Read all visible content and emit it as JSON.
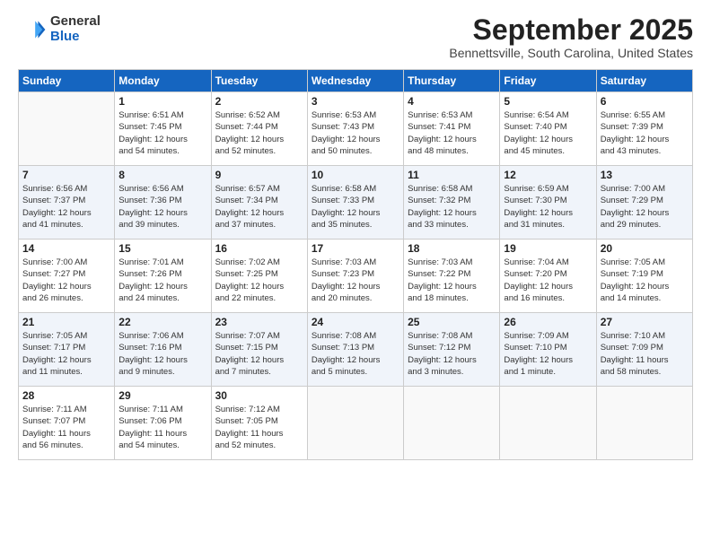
{
  "logo": {
    "general": "General",
    "blue": "Blue"
  },
  "title": {
    "month_year": "September 2025",
    "location": "Bennettsville, South Carolina, United States"
  },
  "days_of_week": [
    "Sunday",
    "Monday",
    "Tuesday",
    "Wednesday",
    "Thursday",
    "Friday",
    "Saturday"
  ],
  "weeks": [
    [
      {
        "day": "",
        "info": ""
      },
      {
        "day": "1",
        "info": "Sunrise: 6:51 AM\nSunset: 7:45 PM\nDaylight: 12 hours\nand 54 minutes."
      },
      {
        "day": "2",
        "info": "Sunrise: 6:52 AM\nSunset: 7:44 PM\nDaylight: 12 hours\nand 52 minutes."
      },
      {
        "day": "3",
        "info": "Sunrise: 6:53 AM\nSunset: 7:43 PM\nDaylight: 12 hours\nand 50 minutes."
      },
      {
        "day": "4",
        "info": "Sunrise: 6:53 AM\nSunset: 7:41 PM\nDaylight: 12 hours\nand 48 minutes."
      },
      {
        "day": "5",
        "info": "Sunrise: 6:54 AM\nSunset: 7:40 PM\nDaylight: 12 hours\nand 45 minutes."
      },
      {
        "day": "6",
        "info": "Sunrise: 6:55 AM\nSunset: 7:39 PM\nDaylight: 12 hours\nand 43 minutes."
      }
    ],
    [
      {
        "day": "7",
        "info": "Sunrise: 6:56 AM\nSunset: 7:37 PM\nDaylight: 12 hours\nand 41 minutes."
      },
      {
        "day": "8",
        "info": "Sunrise: 6:56 AM\nSunset: 7:36 PM\nDaylight: 12 hours\nand 39 minutes."
      },
      {
        "day": "9",
        "info": "Sunrise: 6:57 AM\nSunset: 7:34 PM\nDaylight: 12 hours\nand 37 minutes."
      },
      {
        "day": "10",
        "info": "Sunrise: 6:58 AM\nSunset: 7:33 PM\nDaylight: 12 hours\nand 35 minutes."
      },
      {
        "day": "11",
        "info": "Sunrise: 6:58 AM\nSunset: 7:32 PM\nDaylight: 12 hours\nand 33 minutes."
      },
      {
        "day": "12",
        "info": "Sunrise: 6:59 AM\nSunset: 7:30 PM\nDaylight: 12 hours\nand 31 minutes."
      },
      {
        "day": "13",
        "info": "Sunrise: 7:00 AM\nSunset: 7:29 PM\nDaylight: 12 hours\nand 29 minutes."
      }
    ],
    [
      {
        "day": "14",
        "info": "Sunrise: 7:00 AM\nSunset: 7:27 PM\nDaylight: 12 hours\nand 26 minutes."
      },
      {
        "day": "15",
        "info": "Sunrise: 7:01 AM\nSunset: 7:26 PM\nDaylight: 12 hours\nand 24 minutes."
      },
      {
        "day": "16",
        "info": "Sunrise: 7:02 AM\nSunset: 7:25 PM\nDaylight: 12 hours\nand 22 minutes."
      },
      {
        "day": "17",
        "info": "Sunrise: 7:03 AM\nSunset: 7:23 PM\nDaylight: 12 hours\nand 20 minutes."
      },
      {
        "day": "18",
        "info": "Sunrise: 7:03 AM\nSunset: 7:22 PM\nDaylight: 12 hours\nand 18 minutes."
      },
      {
        "day": "19",
        "info": "Sunrise: 7:04 AM\nSunset: 7:20 PM\nDaylight: 12 hours\nand 16 minutes."
      },
      {
        "day": "20",
        "info": "Sunrise: 7:05 AM\nSunset: 7:19 PM\nDaylight: 12 hours\nand 14 minutes."
      }
    ],
    [
      {
        "day": "21",
        "info": "Sunrise: 7:05 AM\nSunset: 7:17 PM\nDaylight: 12 hours\nand 11 minutes."
      },
      {
        "day": "22",
        "info": "Sunrise: 7:06 AM\nSunset: 7:16 PM\nDaylight: 12 hours\nand 9 minutes."
      },
      {
        "day": "23",
        "info": "Sunrise: 7:07 AM\nSunset: 7:15 PM\nDaylight: 12 hours\nand 7 minutes."
      },
      {
        "day": "24",
        "info": "Sunrise: 7:08 AM\nSunset: 7:13 PM\nDaylight: 12 hours\nand 5 minutes."
      },
      {
        "day": "25",
        "info": "Sunrise: 7:08 AM\nSunset: 7:12 PM\nDaylight: 12 hours\nand 3 minutes."
      },
      {
        "day": "26",
        "info": "Sunrise: 7:09 AM\nSunset: 7:10 PM\nDaylight: 12 hours\nand 1 minute."
      },
      {
        "day": "27",
        "info": "Sunrise: 7:10 AM\nSunset: 7:09 PM\nDaylight: 11 hours\nand 58 minutes."
      }
    ],
    [
      {
        "day": "28",
        "info": "Sunrise: 7:11 AM\nSunset: 7:07 PM\nDaylight: 11 hours\nand 56 minutes."
      },
      {
        "day": "29",
        "info": "Sunrise: 7:11 AM\nSunset: 7:06 PM\nDaylight: 11 hours\nand 54 minutes."
      },
      {
        "day": "30",
        "info": "Sunrise: 7:12 AM\nSunset: 7:05 PM\nDaylight: 11 hours\nand 52 minutes."
      },
      {
        "day": "",
        "info": ""
      },
      {
        "day": "",
        "info": ""
      },
      {
        "day": "",
        "info": ""
      },
      {
        "day": "",
        "info": ""
      }
    ]
  ]
}
